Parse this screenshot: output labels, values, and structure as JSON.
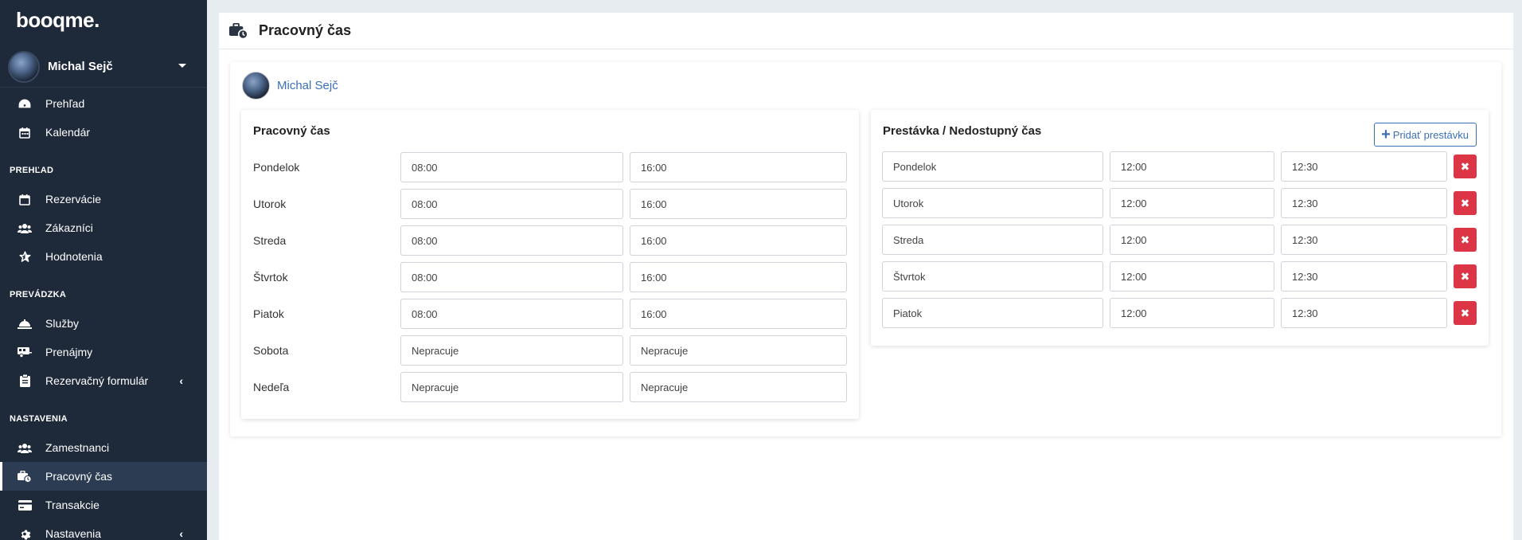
{
  "sidebar": {
    "logo": "booqme.",
    "user_name": "Michal Sejč",
    "top_items": [
      {
        "label": "Prehľad",
        "icon": "gauge-icon"
      },
      {
        "label": "Kalendár",
        "icon": "calendar-icon"
      }
    ],
    "sections": [
      {
        "title": "PREHĽAD",
        "items": [
          {
            "label": "Rezervácie",
            "icon": "calendar-blank-icon"
          },
          {
            "label": "Zákazníci",
            "icon": "users-icon"
          },
          {
            "label": "Hodnotenia",
            "icon": "star-icon"
          }
        ]
      },
      {
        "title": "PREVÁDZKA",
        "items": [
          {
            "label": "Služby",
            "icon": "bell-service-icon"
          },
          {
            "label": "Prenájmy",
            "icon": "trailer-icon"
          },
          {
            "label": "Rezervačný formulár",
            "icon": "form-icon",
            "has_chevron": true
          }
        ]
      },
      {
        "title": "NASTAVENIA",
        "items": [
          {
            "label": "Zamestnanci",
            "icon": "users-icon"
          },
          {
            "label": "Pracovný čas",
            "icon": "briefcase-clock-icon",
            "active": true
          },
          {
            "label": "Transakcie",
            "icon": "credit-card-icon"
          },
          {
            "label": "Nastavenia",
            "icon": "gear-icon",
            "has_chevron": true
          }
        ]
      }
    ]
  },
  "page": {
    "title": "Pracovný čas",
    "employee_name": "Michal Sejč"
  },
  "working_hours": {
    "title": "Pracovný čas",
    "rows": [
      {
        "day": "Pondelok",
        "from": "08:00",
        "to": "16:00"
      },
      {
        "day": "Utorok",
        "from": "08:00",
        "to": "16:00"
      },
      {
        "day": "Streda",
        "from": "08:00",
        "to": "16:00"
      },
      {
        "day": "Štvrtok",
        "from": "08:00",
        "to": "16:00"
      },
      {
        "day": "Piatok",
        "from": "08:00",
        "to": "16:00"
      },
      {
        "day": "Sobota",
        "from": "Nepracuje",
        "to": "Nepracuje"
      },
      {
        "day": "Nedeľa",
        "from": "Nepracuje",
        "to": "Nepracuje"
      }
    ]
  },
  "breaks": {
    "title": "Prestávka / Nedostupný čas",
    "add_label": "Pridať prestávku",
    "rows": [
      {
        "day": "Pondelok",
        "from": "12:00",
        "to": "12:30"
      },
      {
        "day": "Utorok",
        "from": "12:00",
        "to": "12:30"
      },
      {
        "day": "Streda",
        "from": "12:00",
        "to": "12:30"
      },
      {
        "day": "Štvrtok",
        "from": "12:00",
        "to": "12:30"
      },
      {
        "day": "Piatok",
        "from": "12:00",
        "to": "12:30"
      }
    ]
  },
  "colors": {
    "sidebar_bg": "#1e2a3a",
    "accent": "#3b6fb6",
    "danger": "#dc3545"
  }
}
